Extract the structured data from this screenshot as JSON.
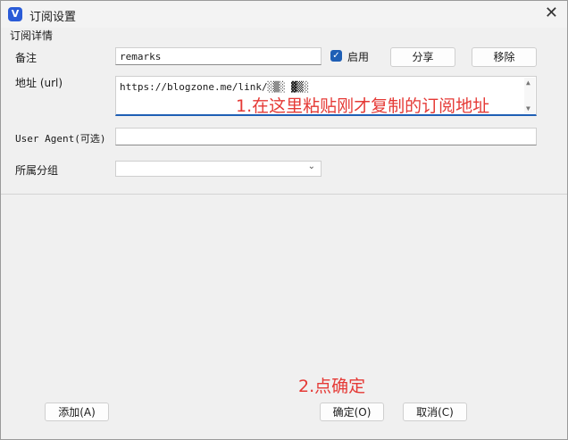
{
  "window": {
    "title": "订阅设置",
    "app_icon": "V"
  },
  "group": {
    "label": "订阅详情"
  },
  "fields": {
    "remarks_label": "备注",
    "remarks_value": "remarks",
    "enabled_label": "启用",
    "enabled": true,
    "url_label": "地址 (url)",
    "url_value": "https://blogzone.me/link/░▒░ ▓▒░",
    "user_agent_label": "User Agent(可选)",
    "user_agent_value": "",
    "group_label": "所属分组",
    "group_value": ""
  },
  "buttons": {
    "share": "分享",
    "remove": "移除",
    "add": "添加(A)",
    "ok": "确定(O)",
    "cancel": "取消(C)"
  },
  "annotations": {
    "step1": "1.在这里粘贴刚才复制的订阅地址",
    "step2": "2.点确定",
    "color": "#e53935"
  },
  "icons": {
    "close": "close-icon",
    "checkbox": "check-icon",
    "dropdown": "chevron-down-icon"
  }
}
